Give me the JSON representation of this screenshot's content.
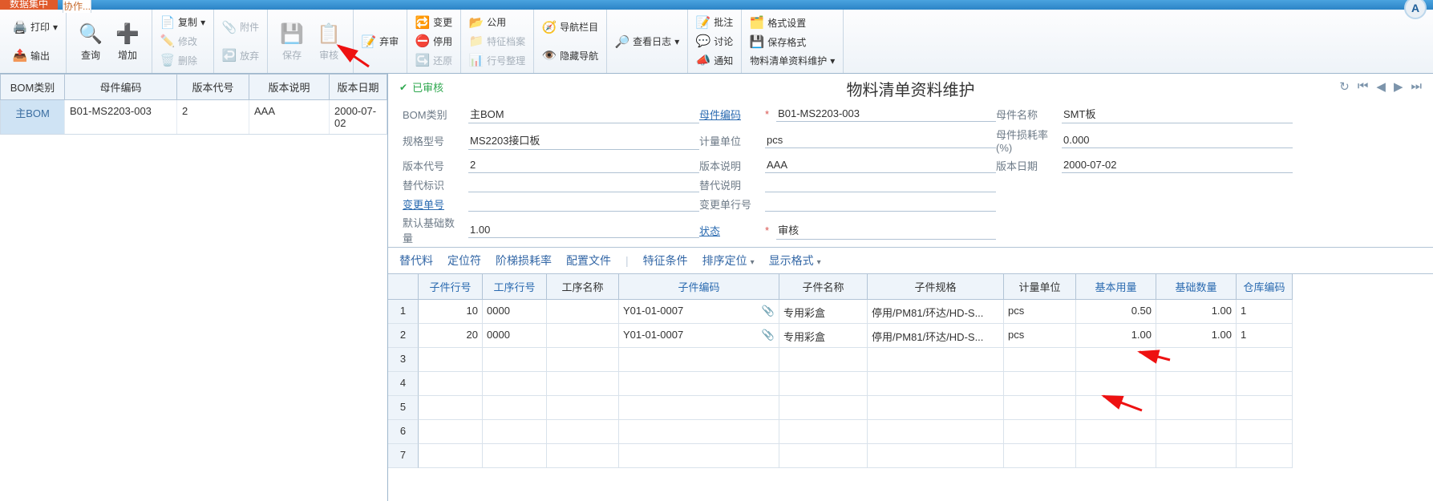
{
  "appbar": {
    "tab1": "数据集中",
    "tab2": "协作...",
    "avatar": "A"
  },
  "ribbon": {
    "print": "打印",
    "export": "输出",
    "search": "查询",
    "add": "增加",
    "copy": "复制",
    "edit": "修改",
    "delete": "删除",
    "attachment": "附件",
    "discard": "放弃",
    "save": "保存",
    "audit": "审核",
    "reject": "弃审",
    "change": "变更",
    "stop": "停用",
    "restore": "还原",
    "public": "公用",
    "special": "特征档案",
    "line_tidy": "行号整理",
    "navbar": "导航栏目",
    "hide_nav": "隐藏导航",
    "view_log": "查看日志",
    "remark": "批注",
    "discuss": "讨论",
    "notify": "通知",
    "format_set": "格式设置",
    "save_format": "保存格式",
    "bom_maint": "物料清单资料维护"
  },
  "left": {
    "headers": [
      "BOM类别",
      "母件编码",
      "版本代号",
      "版本说明",
      "版本日期"
    ],
    "row": {
      "type": "主BOM",
      "code": "B01-MS2203-003",
      "ver": "2",
      "desc": "AAA",
      "date": "2000-07-02"
    }
  },
  "right": {
    "status": "已审核",
    "title": "物料清单资料维护",
    "form": {
      "bom_type_lbl": "BOM类别",
      "bom_type": "主BOM",
      "parent_code_lbl": "母件编码",
      "parent_code": "B01-MS2203-003",
      "parent_name_lbl": "母件名称",
      "parent_name": "SMT板",
      "spec_lbl": "规格型号",
      "spec": "MS2203接口板",
      "uom_lbl": "计量单位",
      "uom": "pcs",
      "loss_lbl": "母件损耗率(%)",
      "loss": "0.000",
      "ver_lbl": "版本代号",
      "ver": "2",
      "ver_desc_lbl": "版本说明",
      "ver_desc": "AAA",
      "ver_date_lbl": "版本日期",
      "ver_date": "2000-07-02",
      "alt_id_lbl": "替代标识",
      "alt_id": "",
      "alt_desc_lbl": "替代说明",
      "alt_desc": "",
      "chg_no_lbl": "变更单号",
      "chg_no": "",
      "chg_line_lbl": "变更单行号",
      "chg_line": "",
      "def_qty_lbl": "默认基础数量",
      "def_qty": "1.00",
      "state_lbl": "状态",
      "state": "审核"
    },
    "subtabs": {
      "alt": "替代料",
      "loc": "定位符",
      "step_loss": "阶梯损耗率",
      "cfg": "配置文件",
      "cond": "特征条件",
      "sort": "排序定位",
      "disp": "显示格式"
    },
    "grid": {
      "headers": [
        "",
        "子件行号",
        "工序行号",
        "工序名称",
        "子件编码",
        "子件名称",
        "子件规格",
        "计量单位",
        "基本用量",
        "基础数量",
        "仓库编码"
      ],
      "rows": [
        {
          "n": "1",
          "line": "10",
          "op": "0000",
          "opname": "",
          "code": "Y01-01-0007",
          "name": "专用彩盒",
          "spec": "停用/PM81/环达/HD-S...",
          "uom": "pcs",
          "base": "0.50",
          "qty": "1.00",
          "wh": "1"
        },
        {
          "n": "2",
          "line": "20",
          "op": "0000",
          "opname": "",
          "code": "Y01-01-0007",
          "name": "专用彩盒",
          "spec": "停用/PM81/环达/HD-S...",
          "uom": "pcs",
          "base": "1.00",
          "qty": "1.00",
          "wh": "1"
        },
        {
          "n": "3"
        },
        {
          "n": "4"
        },
        {
          "n": "5"
        },
        {
          "n": "6"
        },
        {
          "n": "7"
        }
      ]
    }
  }
}
